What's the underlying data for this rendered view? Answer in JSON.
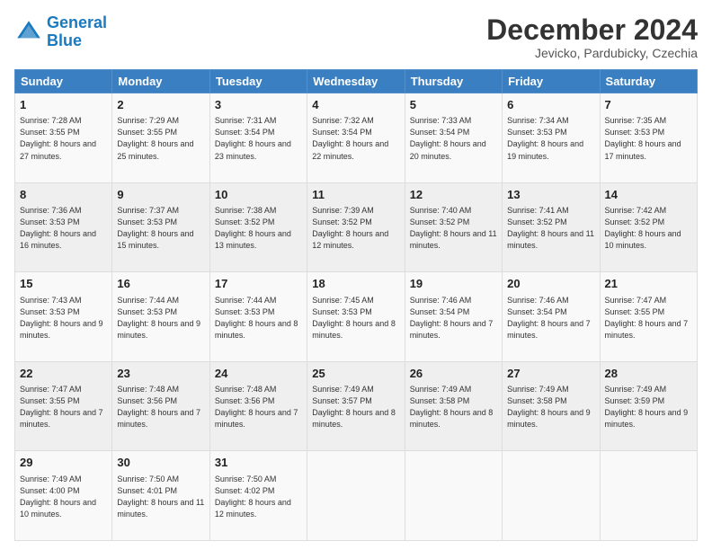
{
  "header": {
    "logo_line1": "General",
    "logo_line2": "Blue",
    "month_title": "December 2024",
    "location": "Jevicko, Pardubicky, Czechia"
  },
  "days_of_week": [
    "Sunday",
    "Monday",
    "Tuesday",
    "Wednesday",
    "Thursday",
    "Friday",
    "Saturday"
  ],
  "weeks": [
    [
      {
        "day": "1",
        "sunrise": "7:28 AM",
        "sunset": "3:55 PM",
        "daylight": "8 hours and 27 minutes."
      },
      {
        "day": "2",
        "sunrise": "7:29 AM",
        "sunset": "3:55 PM",
        "daylight": "8 hours and 25 minutes."
      },
      {
        "day": "3",
        "sunrise": "7:31 AM",
        "sunset": "3:54 PM",
        "daylight": "8 hours and 23 minutes."
      },
      {
        "day": "4",
        "sunrise": "7:32 AM",
        "sunset": "3:54 PM",
        "daylight": "8 hours and 22 minutes."
      },
      {
        "day": "5",
        "sunrise": "7:33 AM",
        "sunset": "3:54 PM",
        "daylight": "8 hours and 20 minutes."
      },
      {
        "day": "6",
        "sunrise": "7:34 AM",
        "sunset": "3:53 PM",
        "daylight": "8 hours and 19 minutes."
      },
      {
        "day": "7",
        "sunrise": "7:35 AM",
        "sunset": "3:53 PM",
        "daylight": "8 hours and 17 minutes."
      }
    ],
    [
      {
        "day": "8",
        "sunrise": "7:36 AM",
        "sunset": "3:53 PM",
        "daylight": "8 hours and 16 minutes."
      },
      {
        "day": "9",
        "sunrise": "7:37 AM",
        "sunset": "3:53 PM",
        "daylight": "8 hours and 15 minutes."
      },
      {
        "day": "10",
        "sunrise": "7:38 AM",
        "sunset": "3:52 PM",
        "daylight": "8 hours and 13 minutes."
      },
      {
        "day": "11",
        "sunrise": "7:39 AM",
        "sunset": "3:52 PM",
        "daylight": "8 hours and 12 minutes."
      },
      {
        "day": "12",
        "sunrise": "7:40 AM",
        "sunset": "3:52 PM",
        "daylight": "8 hours and 11 minutes."
      },
      {
        "day": "13",
        "sunrise": "7:41 AM",
        "sunset": "3:52 PM",
        "daylight": "8 hours and 11 minutes."
      },
      {
        "day": "14",
        "sunrise": "7:42 AM",
        "sunset": "3:52 PM",
        "daylight": "8 hours and 10 minutes."
      }
    ],
    [
      {
        "day": "15",
        "sunrise": "7:43 AM",
        "sunset": "3:53 PM",
        "daylight": "8 hours and 9 minutes."
      },
      {
        "day": "16",
        "sunrise": "7:44 AM",
        "sunset": "3:53 PM",
        "daylight": "8 hours and 9 minutes."
      },
      {
        "day": "17",
        "sunrise": "7:44 AM",
        "sunset": "3:53 PM",
        "daylight": "8 hours and 8 minutes."
      },
      {
        "day": "18",
        "sunrise": "7:45 AM",
        "sunset": "3:53 PM",
        "daylight": "8 hours and 8 minutes."
      },
      {
        "day": "19",
        "sunrise": "7:46 AM",
        "sunset": "3:54 PM",
        "daylight": "8 hours and 7 minutes."
      },
      {
        "day": "20",
        "sunrise": "7:46 AM",
        "sunset": "3:54 PM",
        "daylight": "8 hours and 7 minutes."
      },
      {
        "day": "21",
        "sunrise": "7:47 AM",
        "sunset": "3:55 PM",
        "daylight": "8 hours and 7 minutes."
      }
    ],
    [
      {
        "day": "22",
        "sunrise": "7:47 AM",
        "sunset": "3:55 PM",
        "daylight": "8 hours and 7 minutes."
      },
      {
        "day": "23",
        "sunrise": "7:48 AM",
        "sunset": "3:56 PM",
        "daylight": "8 hours and 7 minutes."
      },
      {
        "day": "24",
        "sunrise": "7:48 AM",
        "sunset": "3:56 PM",
        "daylight": "8 hours and 7 minutes."
      },
      {
        "day": "25",
        "sunrise": "7:49 AM",
        "sunset": "3:57 PM",
        "daylight": "8 hours and 8 minutes."
      },
      {
        "day": "26",
        "sunrise": "7:49 AM",
        "sunset": "3:58 PM",
        "daylight": "8 hours and 8 minutes."
      },
      {
        "day": "27",
        "sunrise": "7:49 AM",
        "sunset": "3:58 PM",
        "daylight": "8 hours and 9 minutes."
      },
      {
        "day": "28",
        "sunrise": "7:49 AM",
        "sunset": "3:59 PM",
        "daylight": "8 hours and 9 minutes."
      }
    ],
    [
      {
        "day": "29",
        "sunrise": "7:49 AM",
        "sunset": "4:00 PM",
        "daylight": "8 hours and 10 minutes."
      },
      {
        "day": "30",
        "sunrise": "7:50 AM",
        "sunset": "4:01 PM",
        "daylight": "8 hours and 11 minutes."
      },
      {
        "day": "31",
        "sunrise": "7:50 AM",
        "sunset": "4:02 PM",
        "daylight": "8 hours and 12 minutes."
      },
      null,
      null,
      null,
      null
    ]
  ]
}
